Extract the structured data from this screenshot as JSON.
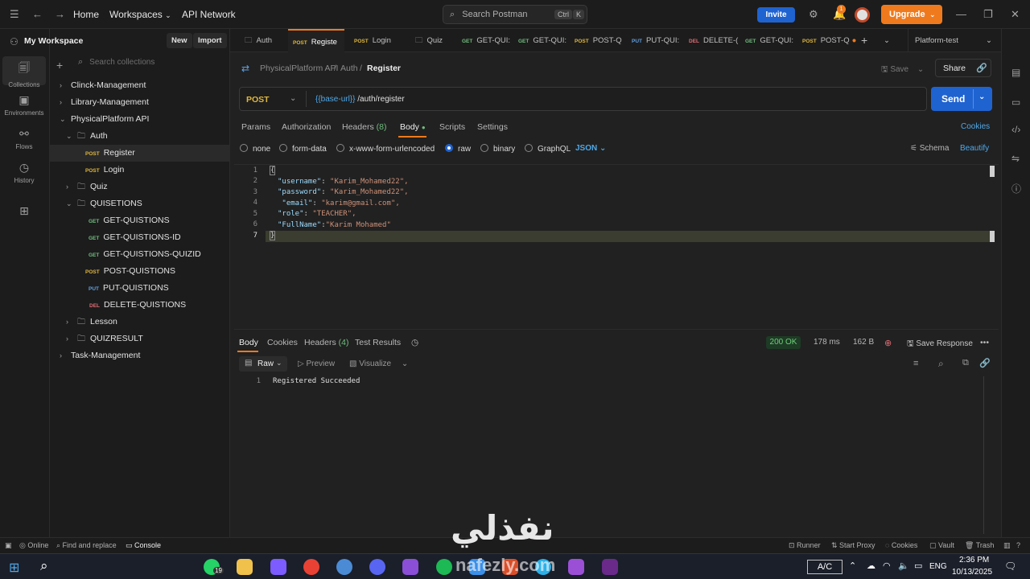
{
  "topbar": {
    "home": "Home",
    "workspaces": "Workspaces",
    "api_network": "API Network",
    "search_placeholder": "Search Postman",
    "kbd1": "Ctrl",
    "kbd2": "K",
    "invite": "Invite",
    "notif_count": "1",
    "upgrade": "Upgrade"
  },
  "leftstrip": [
    {
      "label": "Collections",
      "icon": "collections-icon"
    },
    {
      "label": "Environments",
      "icon": "environments-icon"
    },
    {
      "label": "Flows",
      "icon": "flows-icon"
    },
    {
      "label": "History",
      "icon": "history-icon"
    }
  ],
  "sidebar": {
    "workspace": "My Workspace",
    "new": "New",
    "import": "Import",
    "search_placeholder": "Search collections",
    "tree": [
      {
        "label": "Clinck-Management",
        "type": "collection"
      },
      {
        "label": "Library-Management",
        "type": "collection"
      },
      {
        "label": "PhysicalPlatform API",
        "type": "collection"
      },
      {
        "label": "Auth",
        "type": "folder"
      },
      {
        "label": "Register",
        "method": "POST"
      },
      {
        "label": "Login",
        "method": "POST"
      },
      {
        "label": "Quiz",
        "type": "folder"
      },
      {
        "label": "QUISETIONS",
        "type": "folder"
      },
      {
        "label": "GET-QUISTIONS",
        "method": "GET"
      },
      {
        "label": "GET-QUISTIONS-ID",
        "method": "GET"
      },
      {
        "label": "GET-QUISTIONS-QUIZID",
        "method": "GET"
      },
      {
        "label": "POST-QUISTIONS",
        "method": "POST"
      },
      {
        "label": "PUT-QUISTIONS",
        "method": "PUT"
      },
      {
        "label": "DELETE-QUISTIONS",
        "method": "DEL"
      },
      {
        "label": "Lesson",
        "type": "folder"
      },
      {
        "label": "QUIZRESULT",
        "type": "folder"
      },
      {
        "label": "Task-Management",
        "type": "collection"
      }
    ]
  },
  "tabs": [
    {
      "method": "",
      "label": "Auth"
    },
    {
      "method": "POST",
      "label": "Registe"
    },
    {
      "method": "POST",
      "label": "Login"
    },
    {
      "method": "",
      "label": "Quiz"
    },
    {
      "method": "GET",
      "label": "GET-QUI:"
    },
    {
      "method": "GET",
      "label": "GET-QUI:"
    },
    {
      "method": "POST",
      "label": "POST-Q"
    },
    {
      "method": "PUT",
      "label": "PUT-QUI:"
    },
    {
      "method": "DEL",
      "label": "DELETE-("
    },
    {
      "method": "GET",
      "label": "GET-QUI:"
    },
    {
      "method": "POST",
      "label": "POST-Q"
    }
  ],
  "env": "Platform-test",
  "breadcrumb": {
    "a": "PhysicalPlatform API",
    "b": "Auth",
    "c": "Register",
    "sep": "/"
  },
  "actions": {
    "save": "Save",
    "share": "Share"
  },
  "request": {
    "method": "POST",
    "url_var": "{{base-url}}",
    "url_path": "/auth/register",
    "send": "Send"
  },
  "subtabs": {
    "params": "Params",
    "authorization": "Authorization",
    "headers": "Headers",
    "headers_count": "(8)",
    "body": "Body",
    "scripts": "Scripts",
    "settings": "Settings",
    "cookies": "Cookies"
  },
  "bodytypes": {
    "none": "none",
    "formdata": "form-data",
    "urlencoded": "x-www-form-urlencoded",
    "raw": "raw",
    "binary": "binary",
    "graphql": "GraphQL",
    "json": "JSON",
    "schema": "Schema",
    "beautify": "Beautify"
  },
  "code": [
    {
      "n": "1",
      "text": "{"
    },
    {
      "n": "2",
      "key": "\"username\"",
      "val": "\"Karim_Mohamed22\","
    },
    {
      "n": "3",
      "key": "\"password\"",
      "val": "\"Karim_Mohamed22\","
    },
    {
      "n": "4",
      "key": " \"email\"",
      "val": "\"karim@gmail.com\","
    },
    {
      "n": "5",
      "key": "\"role\"",
      "val": "\"TEACHER\","
    },
    {
      "n": "6",
      "key": "\"FullName\"",
      "val": "\"Karim Mohamed\""
    },
    {
      "n": "7",
      "text": "}"
    }
  ],
  "response": {
    "body": "Body",
    "cookies": "Cookies",
    "headers": "Headers",
    "headers_count": "(4)",
    "tests": "Test Results",
    "status": "200 OK",
    "time": "178 ms",
    "size": "162 B",
    "save": "Save Response",
    "raw": "Raw",
    "preview": "Preview",
    "visualize": "Visualize",
    "line": "1",
    "text": "Registered Succeeded"
  },
  "bottombar": {
    "online": "Online",
    "find": "Find and replace",
    "console": "Console",
    "runner": "Runner",
    "proxy": "Start Proxy",
    "cookies": "Cookies",
    "vault": "Vault",
    "trash": "Trash"
  },
  "taskbar": {
    "badge": "19",
    "kbd": "A/C",
    "lang": "ENG",
    "time": "2:36 PM",
    "date": "10/13/2025"
  },
  "watermark": {
    "ar": "نفذلي",
    "en": "nafezly.com"
  },
  "colors": {
    "accent": "#1f63d1",
    "upgrade": "#ef7a1d",
    "post": "#e0b73d",
    "get": "#6fbd7d",
    "put": "#5fa0e0",
    "del": "#e06c75",
    "ok": "#6fcf7a"
  }
}
